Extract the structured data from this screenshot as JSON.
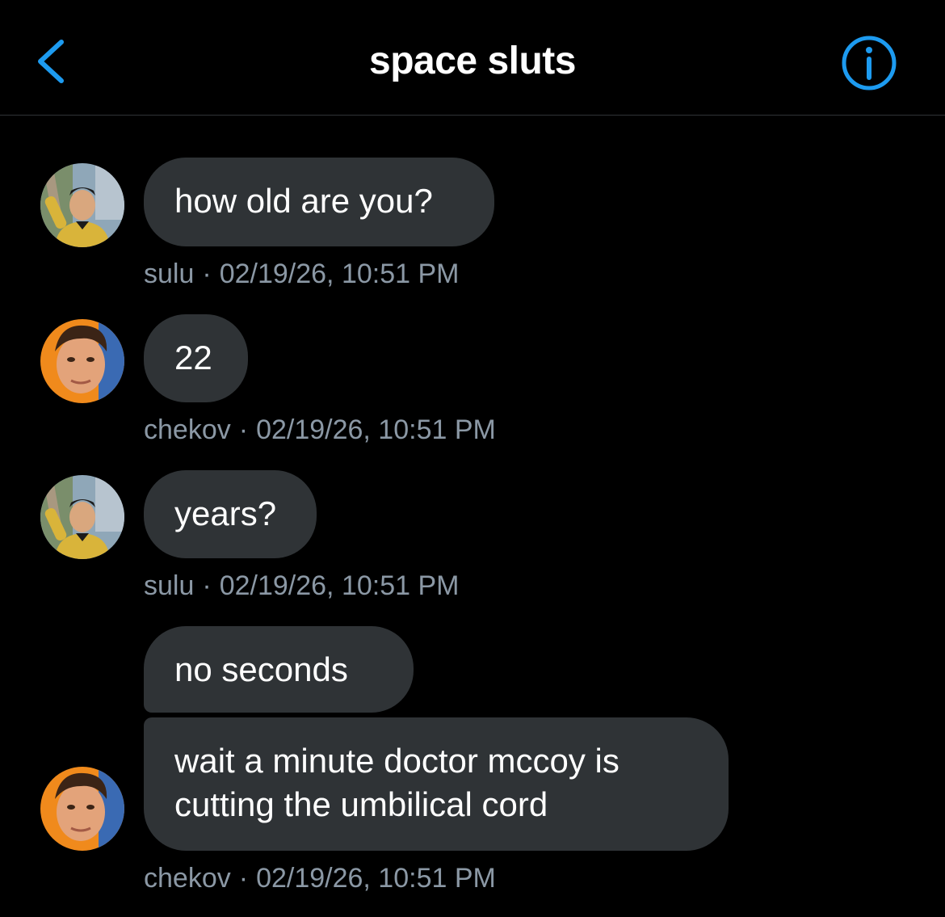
{
  "header": {
    "title": "space sluts",
    "back_icon": "chevron-left-icon",
    "info_icon": "info-icon",
    "accent_color": "#1d9bf0"
  },
  "messages": [
    {
      "sender": "sulu",
      "text": "how old are you?",
      "timestamp": "02/19/26, 10:51 PM"
    },
    {
      "sender": "chekov",
      "text": "22",
      "timestamp": "02/19/26, 10:51 PM"
    },
    {
      "sender": "sulu",
      "text": "years?",
      "timestamp": "02/19/26, 10:51 PM"
    },
    {
      "sender": "chekov",
      "text": "no seconds"
    },
    {
      "sender": "chekov",
      "text_lines": [
        "wait a minute doctor mccoy is",
        "cutting the umbilical cord"
      ],
      "timestamp": "02/19/26, 10:51 PM"
    }
  ],
  "meta_separator": "·",
  "colors": {
    "background": "#000000",
    "bubble": "#2f3336",
    "meta_text": "#8b98a5"
  }
}
